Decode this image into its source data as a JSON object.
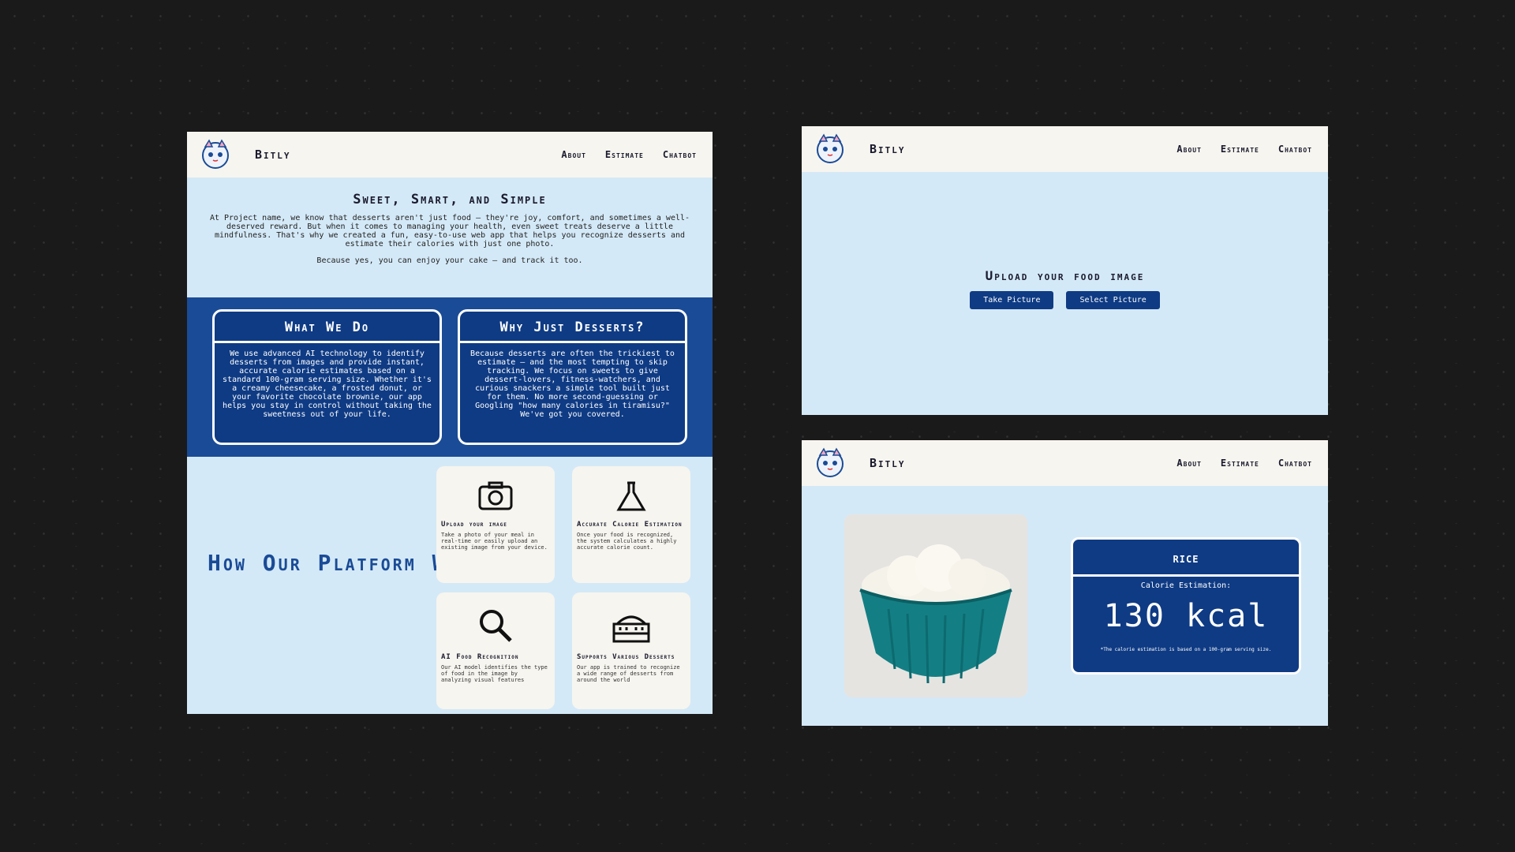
{
  "brand": "Bitly",
  "nav": {
    "about": "About",
    "estimate": "Estimate",
    "chatbot": "Chatbot"
  },
  "home": {
    "hero_title": "Sweet, Smart, and Simple",
    "hero_text": "At Project name, we know that desserts aren't just food — they're joy, comfort, and sometimes a well-deserved reward. But when it comes to managing your health, even sweet treats deserve a little mindfulness. That's why we created a fun, easy-to-use web app that helps you recognize desserts and estimate their calories with just one photo.",
    "hero_tagline": "Because yes, you can enjoy your cake — and track it too.",
    "what_title": "What We Do",
    "what_text": "We use advanced AI technology to identify desserts from images and provide instant, accurate calorie estimates based on a standard 100-gram serving size. Whether it's a creamy cheesecake, a frosted donut, or your favorite chocolate brownie, our app helps you stay in control without taking the sweetness out of your life.",
    "why_title": "Why Just Desserts?",
    "why_text": "Because desserts are often the trickiest to estimate — and the most tempting to skip tracking. We focus on sweets to give dessert-lovers, fitness-watchers, and curious snackers a simple tool built just for them. No more second-guessing or Googling \"how many calories in tiramisu?\" We've got you covered.",
    "how_title": "How Our Platform Works",
    "features": [
      {
        "title": "Upload your image",
        "text": "Take a photo of your meal in real-time or easily upload an existing image from your device.",
        "icon": "camera-icon"
      },
      {
        "title": "Accurate Calorie Estimation",
        "text": "Once your food is recognized, the system calculates a highly accurate calorie count.",
        "icon": "flask-icon"
      },
      {
        "title": "AI Food Recognition",
        "text": "Our AI model identifies the type of food in the image by analyzing visual features",
        "icon": "magnifier-icon"
      },
      {
        "title": "Supports Various Desserts",
        "text": "Our app is trained to recognize a wide range of desserts from around the world",
        "icon": "cake-icon"
      }
    ]
  },
  "upload": {
    "title": "Upload your food image",
    "take_button": "Take Picture",
    "select_button": "Select Picture"
  },
  "result": {
    "food_name": "RICE",
    "estimation_label": "Calorie Estimation:",
    "kcal": "130 kcal",
    "note": "*The calorie estimation is based on a 100-gram serving size."
  },
  "colors": {
    "navy": "#0f3b84",
    "band": "#1a4b96",
    "light_blue": "#d4e9f7",
    "cream": "#f7f5ef"
  }
}
